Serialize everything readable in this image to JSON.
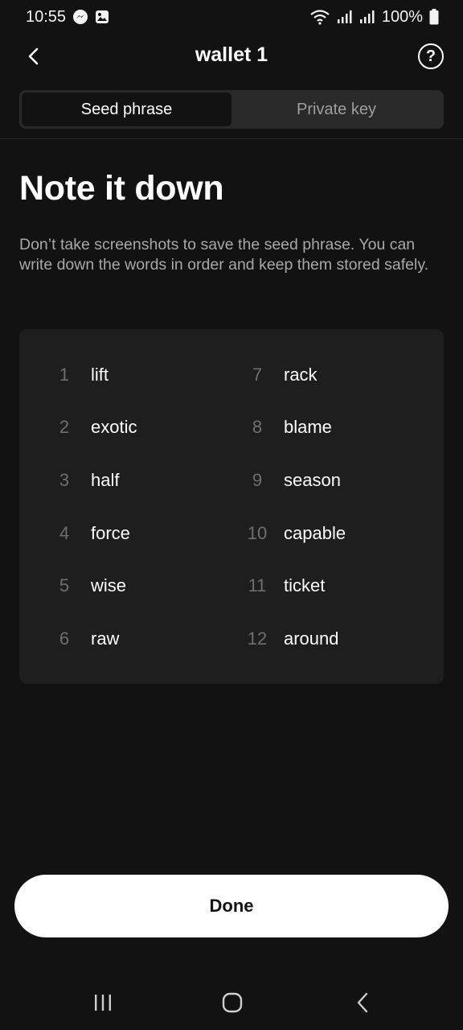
{
  "status_bar": {
    "time": "10:55",
    "battery": "100%"
  },
  "nav": {
    "title": "wallet 1",
    "help_symbol": "?"
  },
  "tabs": [
    {
      "label": "Seed phrase",
      "active": true
    },
    {
      "label": "Private key",
      "active": false
    }
  ],
  "heading": "Note it down",
  "description": "Don’t take screenshots to save the seed phrase. You can write down the words in order and keep them stored safely.",
  "seed_words": [
    {
      "num": "1",
      "word": "lift"
    },
    {
      "num": "2",
      "word": "exotic"
    },
    {
      "num": "3",
      "word": "half"
    },
    {
      "num": "4",
      "word": "force"
    },
    {
      "num": "5",
      "word": "wise"
    },
    {
      "num": "6",
      "word": "raw"
    },
    {
      "num": "7",
      "word": "rack"
    },
    {
      "num": "8",
      "word": "blame"
    },
    {
      "num": "9",
      "word": "season"
    },
    {
      "num": "10",
      "word": "capable"
    },
    {
      "num": "11",
      "word": "ticket"
    },
    {
      "num": "12",
      "word": "around"
    }
  ],
  "done_label": "Done",
  "icons": {
    "messenger": "messenger-icon",
    "gallery": "gallery-icon",
    "wifi": "wifi-icon",
    "signal": "signal-icon",
    "battery": "battery-icon",
    "back": "chevron-left-icon",
    "help": "help-icon",
    "recent_apps": "recent-apps-icon",
    "home": "home-icon",
    "system_back": "back-icon"
  }
}
